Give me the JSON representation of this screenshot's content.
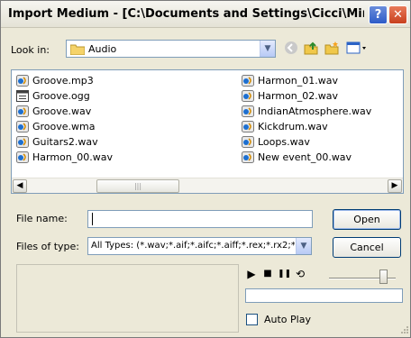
{
  "window": {
    "title": "Import Medium - [C:\\Documents and Settings\\Cicci\\Mina ...",
    "help_label": "?",
    "close_label": "✕"
  },
  "lookin": {
    "label": "Look in:",
    "value": "Audio",
    "icons": [
      "back-icon",
      "up-folder-icon",
      "new-folder-icon",
      "view-menu-icon"
    ]
  },
  "files": {
    "left_column": [
      "Groove.mp3",
      "Groove.ogg",
      "Groove.wav",
      "Groove.wma",
      "Guitars2.wav",
      "Harmon_00.wav"
    ],
    "right_column": [
      "Harmon_01.wav",
      "Harmon_02.wav",
      "IndianAtmosphere.wav",
      "Kickdrum.wav",
      "Loops.wav",
      "New event_00.wav"
    ],
    "scroll_left": "◀",
    "scroll_right": "▶",
    "scroll_thumb": "|||"
  },
  "filename": {
    "label": "File name:",
    "value": ""
  },
  "filetype": {
    "label": "Files of type:",
    "value": "All Types: (*.wav;*.aif;*.aifc;*.aiff;*.rex;*.rx2;*."
  },
  "buttons": {
    "open": "Open",
    "cancel": "Cancel"
  },
  "player": {
    "play": "▶",
    "stop": "■",
    "pause": "❚❚",
    "loop": "⟲",
    "autoplay_label": "Auto Play",
    "autoplay_checked": false
  }
}
